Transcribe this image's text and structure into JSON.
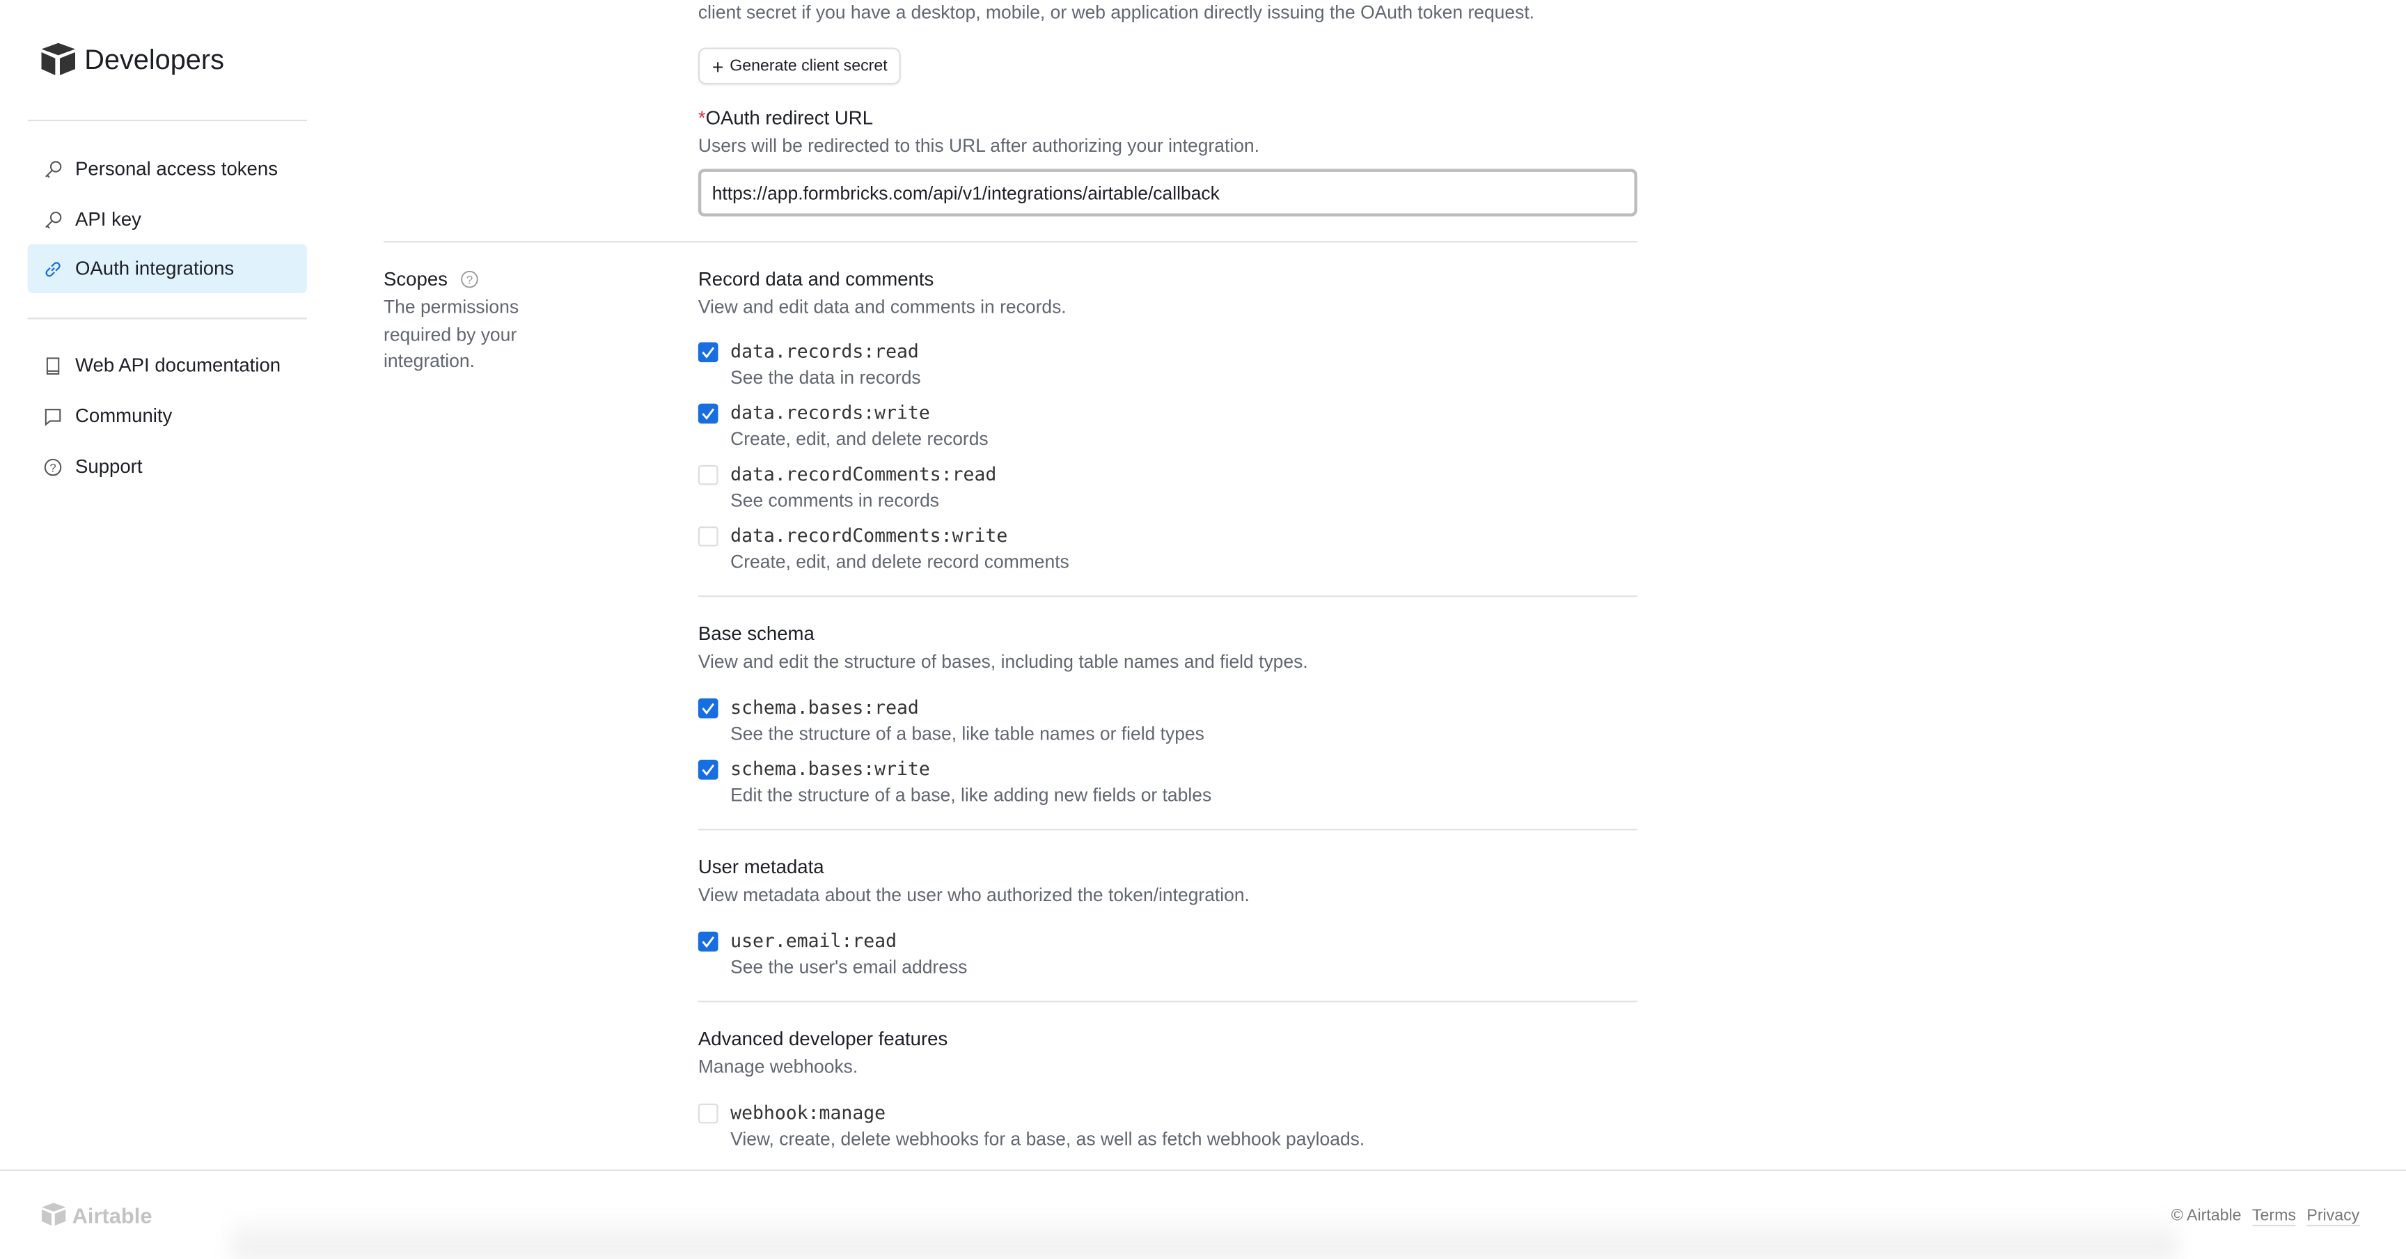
{
  "brand": {
    "title": "Developers",
    "footer_logo": "Airtable"
  },
  "sidebar": {
    "items": [
      {
        "label": "Personal access tokens",
        "icon": "key-icon"
      },
      {
        "label": "API key",
        "icon": "key-icon"
      },
      {
        "label": "OAuth integrations",
        "icon": "link-icon",
        "active": true
      },
      {
        "label": "Web API documentation",
        "icon": "book-icon"
      },
      {
        "label": "Community",
        "icon": "chat-icon"
      },
      {
        "label": "Support",
        "icon": "help-icon"
      }
    ]
  },
  "main": {
    "client_secret_text": "client secret if you have a desktop, mobile, or web application directly issuing the OAuth token request.",
    "generate_button": "Generate client secret",
    "redirect": {
      "required_mark": "*",
      "label": "OAuth redirect URL",
      "help": "Users will be redirected to this URL after authorizing your integration.",
      "value": "https://app.formbricks.com/api/v1/integrations/airtable/callback"
    },
    "scopes": {
      "title": "Scopes",
      "description": "The permissions required by your integration.",
      "groups": [
        {
          "title": "Record data and comments",
          "description": "View and edit data and comments in records.",
          "items": [
            {
              "name": "data.records:read",
              "description": "See the data in records",
              "checked": true
            },
            {
              "name": "data.records:write",
              "description": "Create, edit, and delete records",
              "checked": true
            },
            {
              "name": "data.recordComments:read",
              "description": "See comments in records",
              "checked": false
            },
            {
              "name": "data.recordComments:write",
              "description": "Create, edit, and delete record comments",
              "checked": false
            }
          ]
        },
        {
          "title": "Base schema",
          "description": "View and edit the structure of bases, including table names and field types.",
          "items": [
            {
              "name": "schema.bases:read",
              "description": "See the structure of a base, like table names or field types",
              "checked": true
            },
            {
              "name": "schema.bases:write",
              "description": "Edit the structure of a base, like adding new fields or tables",
              "checked": true
            }
          ]
        },
        {
          "title": "User metadata",
          "description": "View metadata about the user who authorized the token/integration.",
          "items": [
            {
              "name": "user.email:read",
              "description": "See the user's email address",
              "checked": true
            }
          ]
        },
        {
          "title": "Advanced developer features",
          "description": "Manage webhooks.",
          "items": [
            {
              "name": "webhook:manage",
              "description": "View, create, delete webhooks for a base, as well as fetch webhook payloads.",
              "checked": false
            }
          ]
        }
      ]
    }
  },
  "footer": {
    "copyright": "© Airtable",
    "terms": "Terms",
    "privacy": "Privacy"
  },
  "colors": {
    "accent": "#166ee1",
    "active_bg": "#e0f3fd",
    "required": "#e02b45"
  }
}
